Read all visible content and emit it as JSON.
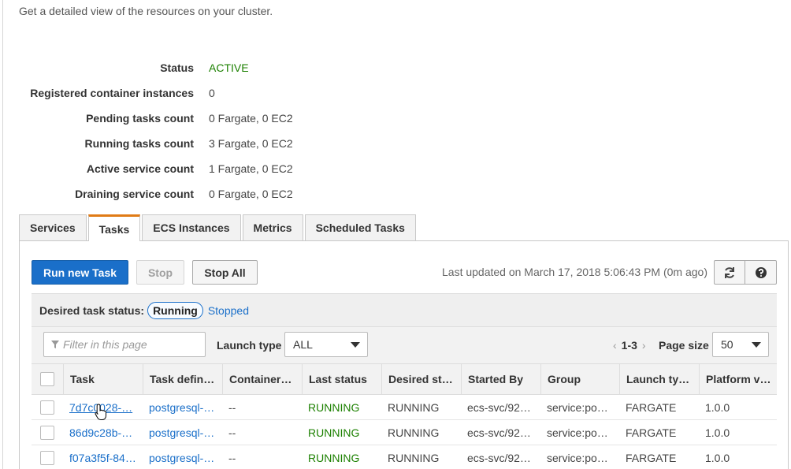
{
  "subtitle": "Get a detailed view of the resources on your cluster.",
  "details": [
    {
      "label": "Status",
      "value": "ACTIVE"
    },
    {
      "label": "Registered container instances",
      "value": "0"
    },
    {
      "label": "Pending tasks count",
      "value": "0 Fargate, 0 EC2"
    },
    {
      "label": "Running tasks count",
      "value": "3 Fargate, 0 EC2"
    },
    {
      "label": "Active service count",
      "value": "1 Fargate, 0 EC2"
    },
    {
      "label": "Draining service count",
      "value": "0 Fargate, 0 EC2"
    }
  ],
  "tabs": [
    "Services",
    "Tasks",
    "ECS Instances",
    "Metrics",
    "Scheduled Tasks"
  ],
  "toolbar": {
    "run_new_task": "Run new Task",
    "stop": "Stop",
    "stop_all": "Stop All",
    "last_updated": "Last updated on March 17, 2018 5:06:43 PM (0m ago)"
  },
  "status_filter": {
    "label": "Desired task status:",
    "running": "Running",
    "stopped": "Stopped"
  },
  "filter": {
    "placeholder": "Filter in this page",
    "launch_type_label": "Launch type",
    "launch_type_value": "ALL",
    "page_range": "1-3",
    "page_size_label": "Page size",
    "page_size_value": "50"
  },
  "table": {
    "headers": [
      "Task",
      "Task defin…",
      "Container…",
      "Last status",
      "Desired st…",
      "Started By",
      "Group",
      "Launch ty…",
      "Platform v…"
    ],
    "rows": [
      [
        "7d7c0028-…",
        "postgresql-…",
        "--",
        "RUNNING",
        "RUNNING",
        "ecs-svc/92…",
        "service:po…",
        "FARGATE",
        "1.0.0"
      ],
      [
        "86d9c28b-…",
        "postgresql-…",
        "--",
        "RUNNING",
        "RUNNING",
        "ecs-svc/92…",
        "service:po…",
        "FARGATE",
        "1.0.0"
      ],
      [
        "f07a3f5f-84…",
        "postgresql-…",
        "--",
        "RUNNING",
        "RUNNING",
        "ecs-svc/92…",
        "service:po…",
        "FARGATE",
        "1.0.0"
      ]
    ]
  },
  "colors": {
    "accent": "#1a6fc9",
    "active_green": "#1d8102",
    "tab_selected": "#e07b16"
  },
  "icons": [
    "refresh-icon",
    "help-icon",
    "filter-icon",
    "chevron-left-icon",
    "chevron-right-icon",
    "caret-down-icon",
    "hand-cursor-icon"
  ]
}
